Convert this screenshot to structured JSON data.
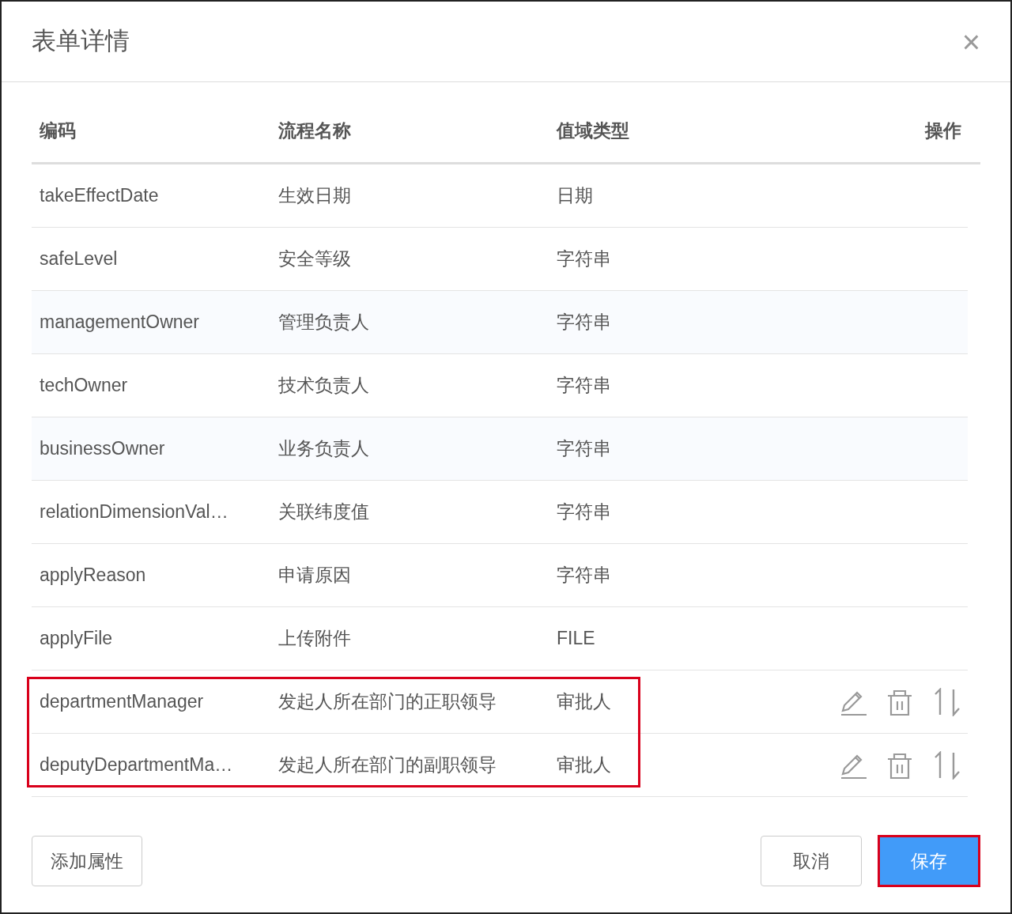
{
  "dialog": {
    "title": "表单详情",
    "close": "×"
  },
  "table": {
    "columns": [
      "编码",
      "流程名称",
      "值域类型",
      "操作"
    ],
    "rows": [
      {
        "code": "takeEffectDate",
        "name": "生效日期",
        "type": "日期",
        "shaded": false,
        "actions": false,
        "marked": false
      },
      {
        "code": "safeLevel",
        "name": "安全等级",
        "type": "字符串",
        "shaded": false,
        "actions": false,
        "marked": false
      },
      {
        "code": "managementOwner",
        "name": "管理负责人",
        "type": "字符串",
        "shaded": true,
        "actions": false,
        "marked": false
      },
      {
        "code": "techOwner",
        "name": "技术负责人",
        "type": "字符串",
        "shaded": false,
        "actions": false,
        "marked": false
      },
      {
        "code": "businessOwner",
        "name": "业务负责人",
        "type": "字符串",
        "shaded": true,
        "actions": false,
        "marked": false
      },
      {
        "code": "relationDimensionVal…",
        "name": "关联纬度值",
        "type": "字符串",
        "shaded": false,
        "actions": false,
        "marked": false
      },
      {
        "code": "applyReason",
        "name": "申请原因",
        "type": "字符串",
        "shaded": false,
        "actions": false,
        "marked": false
      },
      {
        "code": "applyFile",
        "name": "上传附件",
        "type": "FILE",
        "shaded": false,
        "actions": false,
        "marked": false
      },
      {
        "code": "departmentManager",
        "name": "发起人所在部门的正职领导",
        "type": "审批人",
        "shaded": false,
        "actions": true,
        "marked": true
      },
      {
        "code": "deputyDepartmentMa…",
        "name": "发起人所在部门的副职领导",
        "type": "审批人",
        "shaded": false,
        "actions": true,
        "marked": true
      }
    ]
  },
  "footer": {
    "add_button": "添加属性",
    "cancel_button": "取消",
    "save_button": {
      "label": "保存",
      "marked": true
    }
  }
}
